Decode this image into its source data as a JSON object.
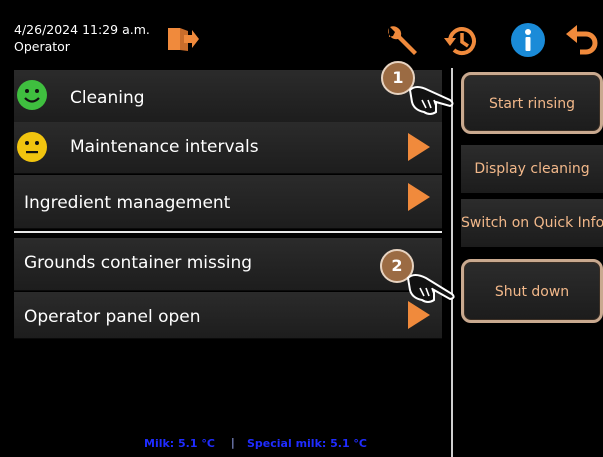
{
  "header": {
    "datetime": "4/26/2024 11:29 a.m.",
    "user": "Operator",
    "icons": [
      "logout-icon",
      "wrench-icon",
      "history-icon",
      "info-icon",
      "back-icon"
    ]
  },
  "list": {
    "items": [
      {
        "label": "Cleaning",
        "status_icon": "smiley-happy-icon"
      },
      {
        "label": "Maintenance intervals",
        "status_icon": "smiley-neutral-icon"
      },
      {
        "label": "Ingredient management"
      },
      {
        "label": "Grounds container missing"
      },
      {
        "label": "Operator panel open"
      }
    ]
  },
  "side_menu": {
    "items": [
      {
        "label": "Start rinsing",
        "highlighted": true,
        "badge": "1"
      },
      {
        "label": "Display cleaning"
      },
      {
        "label": "Switch on Quick Info"
      },
      {
        "label": "Shut down",
        "highlighted": true,
        "badge": "2"
      }
    ]
  },
  "footer": {
    "milk": "Milk: 5.1 °C",
    "separator": "|",
    "special_milk": "Special milk: 5.1 °C"
  },
  "colors": {
    "accent_orange": "#f08a3c",
    "side_text": "#f2b88a",
    "info_blue": "#1a8bd8",
    "footer_blue": "#1f2cff",
    "smiley_green": "#3fbf3f",
    "smiley_yellow": "#f1c40f"
  }
}
